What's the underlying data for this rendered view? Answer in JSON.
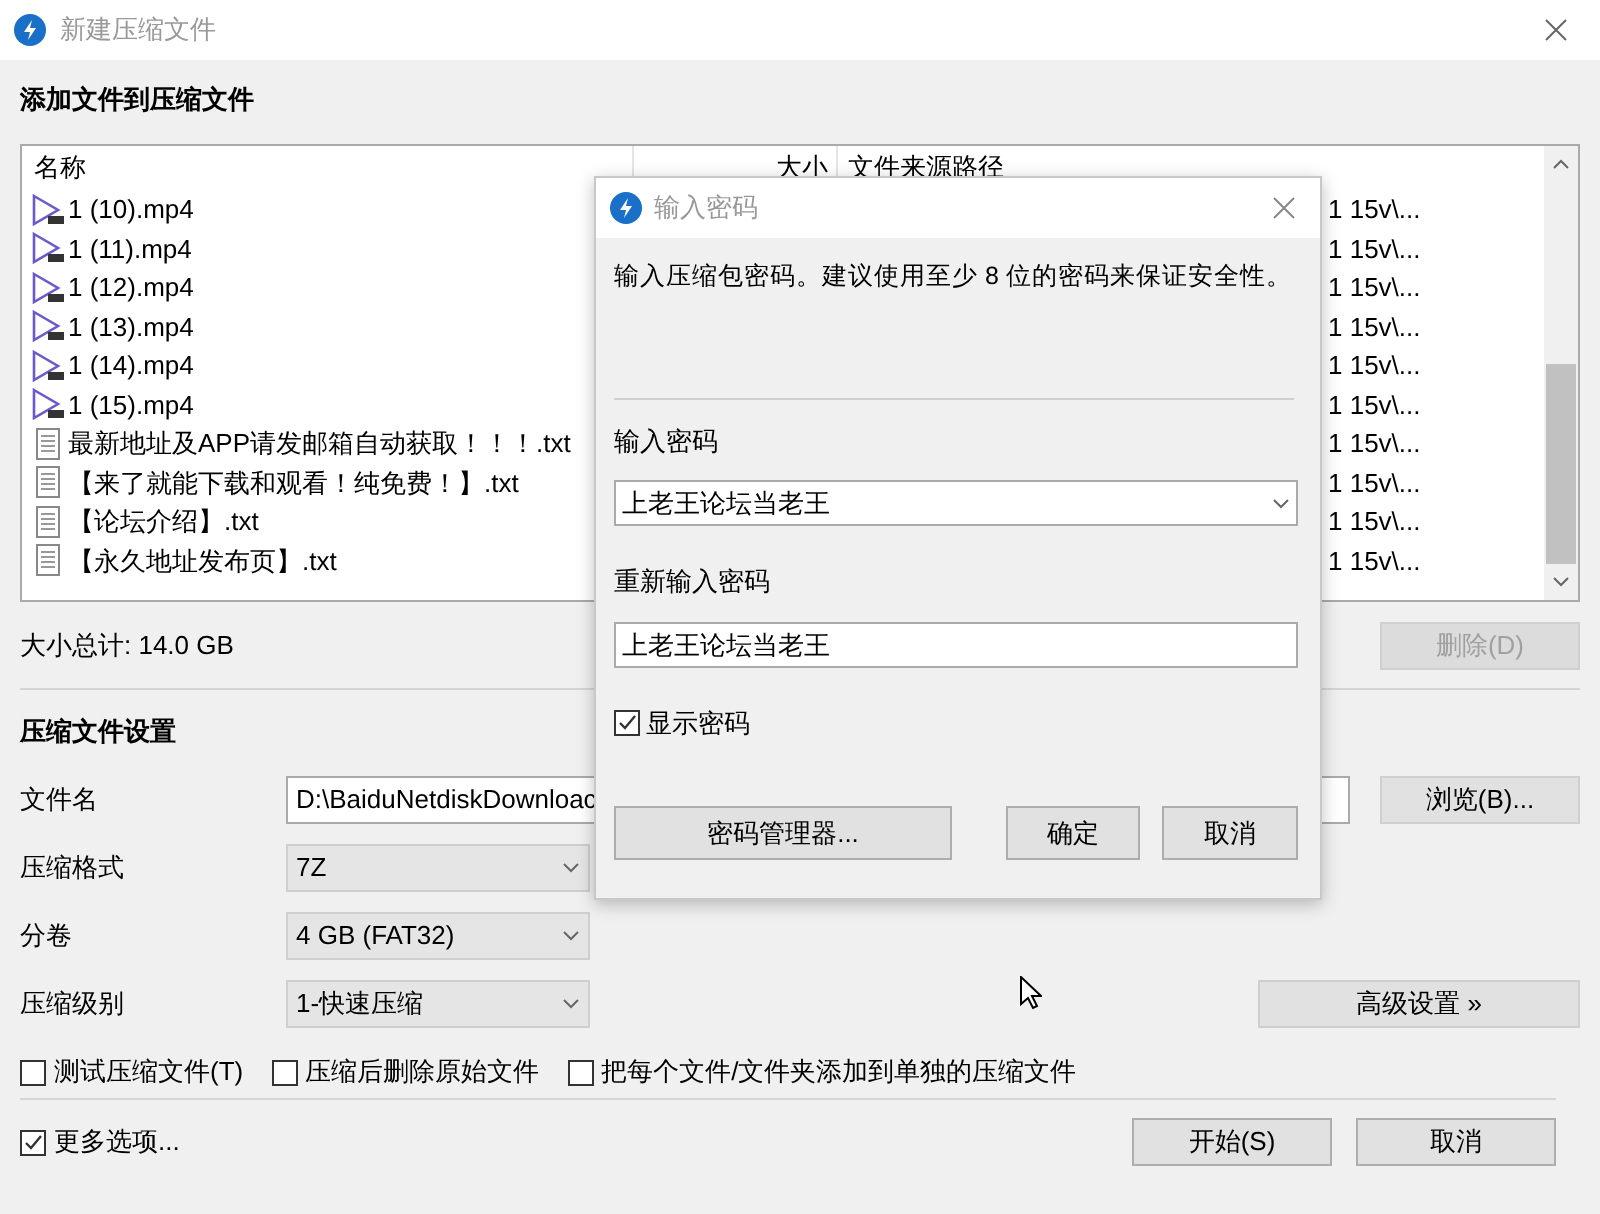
{
  "window": {
    "title": "新建压缩文件"
  },
  "files": {
    "heading": "添加文件到压缩文件",
    "columns": [
      "名称",
      "大小",
      "文件来源路径"
    ],
    "rows": [
      {
        "kind": "video",
        "name": "1 (10).mp4",
        "path": "1 15v\\..."
      },
      {
        "kind": "video",
        "name": "1 (11).mp4",
        "path": "1 15v\\..."
      },
      {
        "kind": "video",
        "name": "1 (12).mp4",
        "path": "1 15v\\..."
      },
      {
        "kind": "video",
        "name": "1 (13).mp4",
        "path": "1 15v\\..."
      },
      {
        "kind": "video",
        "name": "1 (14).mp4",
        "path": "1 15v\\..."
      },
      {
        "kind": "video",
        "name": "1 (15).mp4",
        "path": "1 15v\\..."
      },
      {
        "kind": "text",
        "name": "最新地址及APP请发邮箱自动获取！！！.txt",
        "path": "1 15v\\..."
      },
      {
        "kind": "text",
        "name": "【来了就能下载和观看！纯免费！】.txt",
        "path": "1 15v\\..."
      },
      {
        "kind": "text",
        "name": "【论坛介绍】.txt",
        "path": "1 15v\\..."
      },
      {
        "kind": "text",
        "name": "【永久地址发布页】.txt",
        "path": "1 15v\\..."
      }
    ],
    "total": "大小总计: 14.0 GB",
    "delete_button": {
      "label": "删除(D)",
      "disabled": true
    }
  },
  "settings": {
    "heading": "压缩文件设置",
    "filename": {
      "label": "文件名",
      "value": "D:\\BaiduNetdiskDownloac",
      "browse": "浏览(B)..."
    },
    "format": {
      "label": "压缩格式",
      "value": "7Z"
    },
    "split": {
      "label": "分卷",
      "value": "4 GB (FAT32)"
    },
    "level": {
      "label": "压缩级别",
      "value": "1-快速压缩"
    },
    "advanced_button": "高级设置 »",
    "options": [
      {
        "label": "测试压缩文件(T)",
        "checked": false
      },
      {
        "label": "压缩后删除原始文件",
        "checked": false
      },
      {
        "label": "把每个文件/文件夹添加到单独的压缩文件",
        "checked": false
      }
    ]
  },
  "more_options": {
    "label": "更多选项...",
    "checked": true
  },
  "buttons": {
    "start": "开始(S)",
    "cancel": "取消"
  },
  "password_dialog": {
    "title": "输入密码",
    "message": "输入压缩包密码。建议使用至少 8 位的密码来保证安全性。",
    "password_label": "输入密码",
    "password": "上老王论坛当老王",
    "confirm_label": "重新输入密码",
    "confirm": "上老王论坛当老王",
    "show_password": {
      "label": "显示密码",
      "checked": true
    },
    "buttons": [
      "密码管理器...",
      "确定",
      "取消"
    ]
  }
}
